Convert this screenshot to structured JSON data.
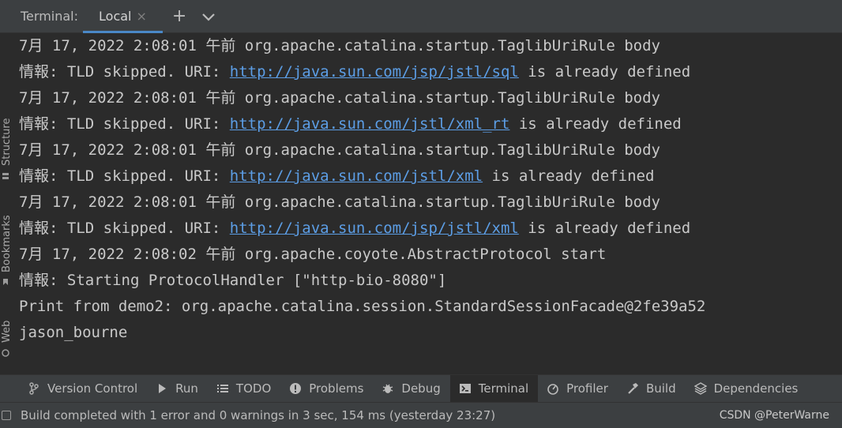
{
  "header": {
    "title": "Terminal:",
    "tab_label": "Local",
    "close_glyph": "×",
    "add_glyph": "+"
  },
  "side_tools": [
    "Structure",
    "Bookmarks",
    "Web"
  ],
  "console": {
    "lines": [
      {
        "pre": "7月 17, 2022 2:08:01 午前 org.apache.catalina.startup.TaglibUriRule body",
        "link": "",
        "post": ""
      },
      {
        "pre": "情報: TLD skipped. URI: ",
        "link": "http://java.sun.com/jsp/jstl/sql",
        "post": " is already defined"
      },
      {
        "pre": "7月 17, 2022 2:08:01 午前 org.apache.catalina.startup.TaglibUriRule body",
        "link": "",
        "post": ""
      },
      {
        "pre": "情報: TLD skipped. URI: ",
        "link": "http://java.sun.com/jstl/xml_rt",
        "post": " is already defined"
      },
      {
        "pre": "7月 17, 2022 2:08:01 午前 org.apache.catalina.startup.TaglibUriRule body",
        "link": "",
        "post": ""
      },
      {
        "pre": "情報: TLD skipped. URI: ",
        "link": "http://java.sun.com/jstl/xml",
        "post": " is already defined"
      },
      {
        "pre": "7月 17, 2022 2:08:01 午前 org.apache.catalina.startup.TaglibUriRule body",
        "link": "",
        "post": ""
      },
      {
        "pre": "情報: TLD skipped. URI: ",
        "link": "http://java.sun.com/jsp/jstl/xml",
        "post": " is already defined"
      },
      {
        "pre": "7月 17, 2022 2:08:02 午前 org.apache.coyote.AbstractProtocol start",
        "link": "",
        "post": ""
      },
      {
        "pre": "情報: Starting ProtocolHandler [\"http-bio-8080\"]",
        "link": "",
        "post": ""
      },
      {
        "pre": "Print from demo2: org.apache.catalina.session.StandardSessionFacade@2fe39a52",
        "link": "",
        "post": ""
      },
      {
        "pre": "jason_bourne",
        "link": "",
        "post": ""
      }
    ]
  },
  "tools": [
    {
      "label": "Version Control",
      "icon": "branch-icon",
      "active": false
    },
    {
      "label": "Run",
      "icon": "run-icon",
      "active": false
    },
    {
      "label": "TODO",
      "icon": "list-icon",
      "active": false
    },
    {
      "label": "Problems",
      "icon": "problems-icon",
      "active": false
    },
    {
      "label": "Debug",
      "icon": "bug-icon",
      "active": false
    },
    {
      "label": "Terminal",
      "icon": "terminal-icon",
      "active": true
    },
    {
      "label": "Profiler",
      "icon": "profiler-icon",
      "active": false
    },
    {
      "label": "Build",
      "icon": "hammer-icon",
      "active": false
    },
    {
      "label": "Dependencies",
      "icon": "layers-icon",
      "active": false
    }
  ],
  "status": {
    "message": "Build completed with 1 error and 0 warnings in 3 sec, 154 ms (yesterday 23:27)",
    "watermark": "CSDN @PeterWarne"
  },
  "colors": {
    "link": "#5c9ee6",
    "tab_underline": "#4a88c7",
    "console_bg": "#2b2b2b",
    "panel_bg": "#3c3f41"
  }
}
